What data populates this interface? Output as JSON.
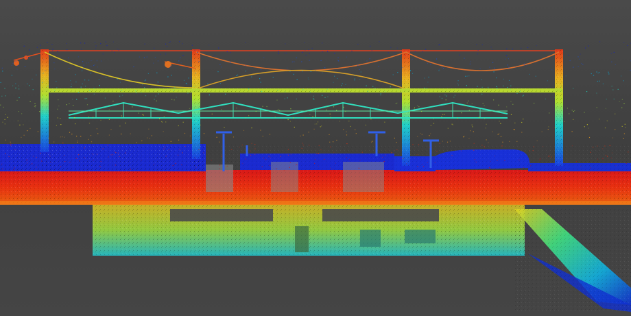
{
  "image": {
    "kind": "lidar-point-cloud-render",
    "subject": "elevated-railway-station-with-overhead-catenary",
    "background_color": "#454545",
    "color_ramp": [
      "#1020c8",
      "#1a50e0",
      "#00b4e6",
      "#20e0c8",
      "#a0e040",
      "#e0e020",
      "#f0a020",
      "#e03010",
      "#c81010"
    ]
  }
}
